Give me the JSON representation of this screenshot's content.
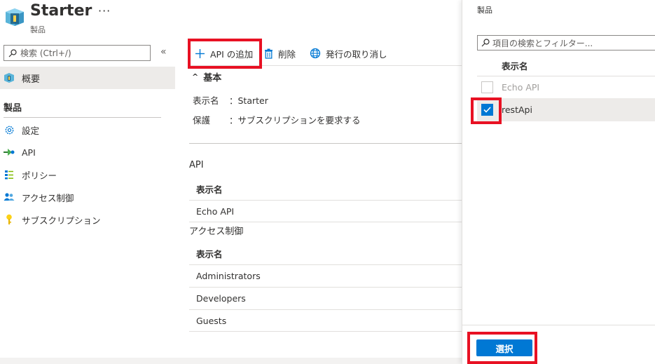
{
  "header": {
    "title": "Starter",
    "more": "···",
    "subtitle": "製品"
  },
  "sidebar": {
    "search_placeholder": "検索 (Ctrl+/)",
    "collapse": "«",
    "overview": "概要",
    "section_title": "製品",
    "items": [
      {
        "label": "設定",
        "icon": "gear-icon"
      },
      {
        "label": "API",
        "icon": "api-icon"
      },
      {
        "label": "ポリシー",
        "icon": "policy-icon"
      },
      {
        "label": "アクセス制御",
        "icon": "people-icon"
      },
      {
        "label": "サブスクリプション",
        "icon": "key-icon"
      }
    ]
  },
  "toolbar": {
    "add_api": "API の追加",
    "delete": "削除",
    "unpublish": "発行の取り消し"
  },
  "essentials": {
    "heading": "基本",
    "display_name_key": "表示名",
    "display_name_value": "：Starter",
    "protection_key": "保護",
    "protection_value": "：サブスクリプションを要求する"
  },
  "api_grid": {
    "title": "API",
    "column": "表示名",
    "rows": [
      "Echo API"
    ]
  },
  "access_grid": {
    "title": "アクセス制御",
    "column": "表示名",
    "rows": [
      "Administrators",
      "Developers",
      "Guests"
    ]
  },
  "panel": {
    "title": "製品",
    "filter_placeholder": "項目の検索とフィルター...",
    "column": "表示名",
    "rows": [
      {
        "label": "Echo API",
        "checked": false,
        "disabled": true
      },
      {
        "label": "restApi",
        "checked": true,
        "disabled": false
      }
    ],
    "select_button": "選択"
  },
  "colors": {
    "accent": "#0078d4",
    "highlight": "#e81123"
  }
}
